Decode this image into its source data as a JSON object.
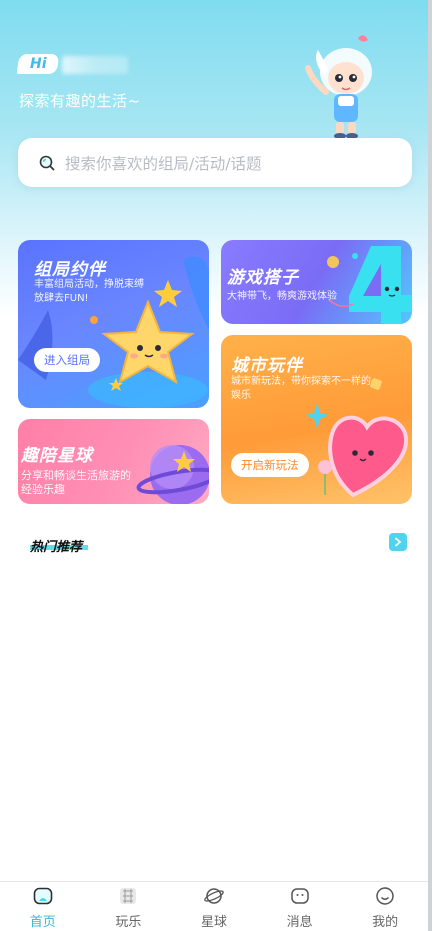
{
  "header": {
    "hi_label": "Hi",
    "tagline": "探索有趣的生活~"
  },
  "search": {
    "placeholder": "搜索你喜欢的组局/活动/话题"
  },
  "cards": [
    {
      "title": "组局约伴",
      "subtitle": "丰富组局活动，挣脱束缚放肆去FUN!",
      "button": "进入组局"
    },
    {
      "title": "游戏搭子",
      "subtitle": "大神带飞，畅爽游戏体验"
    },
    {
      "title": "城市玩伴",
      "subtitle": "城市新玩法，带你探索不一样的娱乐",
      "button": "开启新玩法"
    },
    {
      "title": "趣陪星球",
      "subtitle": "分享和畅谈生活旅游的经验乐趣"
    }
  ],
  "section": {
    "title": "热门推荐"
  },
  "tabbar": {
    "items": [
      {
        "label": "首页",
        "icon": "home-icon",
        "active": true
      },
      {
        "label": "玩乐",
        "icon": "play-icon",
        "active": false
      },
      {
        "label": "星球",
        "icon": "planet-icon",
        "active": false
      },
      {
        "label": "消息",
        "icon": "message-icon",
        "active": false
      },
      {
        "label": "我的",
        "icon": "profile-icon",
        "active": false
      }
    ]
  },
  "colors": {
    "accent": "#3bb6d8",
    "header_top": "#7fdcef",
    "card_group": "#5a73ff",
    "card_game": "#8a7cff",
    "card_city": "#ff9b38",
    "card_planet": "#ff7fa8"
  }
}
